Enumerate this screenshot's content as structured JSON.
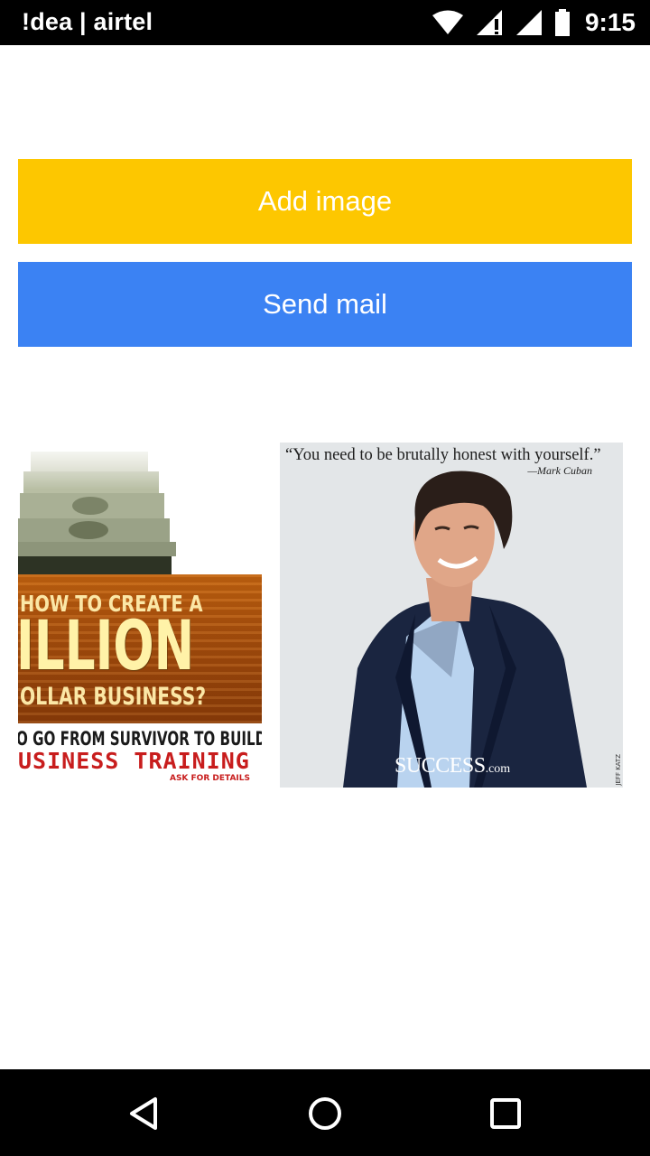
{
  "status_bar": {
    "carrier": "!dea | airtel",
    "time": "9:15",
    "icons": [
      "wifi-icon",
      "signal-icon",
      "signal-icon",
      "battery-icon"
    ]
  },
  "buttons": {
    "add_image_label": "Add image",
    "send_mail_label": "Send mail",
    "add_image_color": "#FDC700",
    "send_mail_color": "#3B82F3"
  },
  "images": [
    {
      "line1": "HOW TO CREATE A",
      "line2": "ILLION",
      "line3": "OLLAR BUSINESS?",
      "line4": "O GO FROM SURVIVOR TO BUILDER.",
      "line5": "USINESS TRAINING",
      "line6": "ASK FOR DETAILS"
    },
    {
      "quote": "“You need to be brutally honest with yourself.”",
      "attribution": "—Mark Cuban",
      "brand": "SUCCESS",
      "brand_suffix": ".com",
      "credit": "JEFF KATZ"
    }
  ],
  "nav_bar": {
    "icons": [
      "back-icon",
      "home-icon",
      "recents-icon"
    ]
  }
}
